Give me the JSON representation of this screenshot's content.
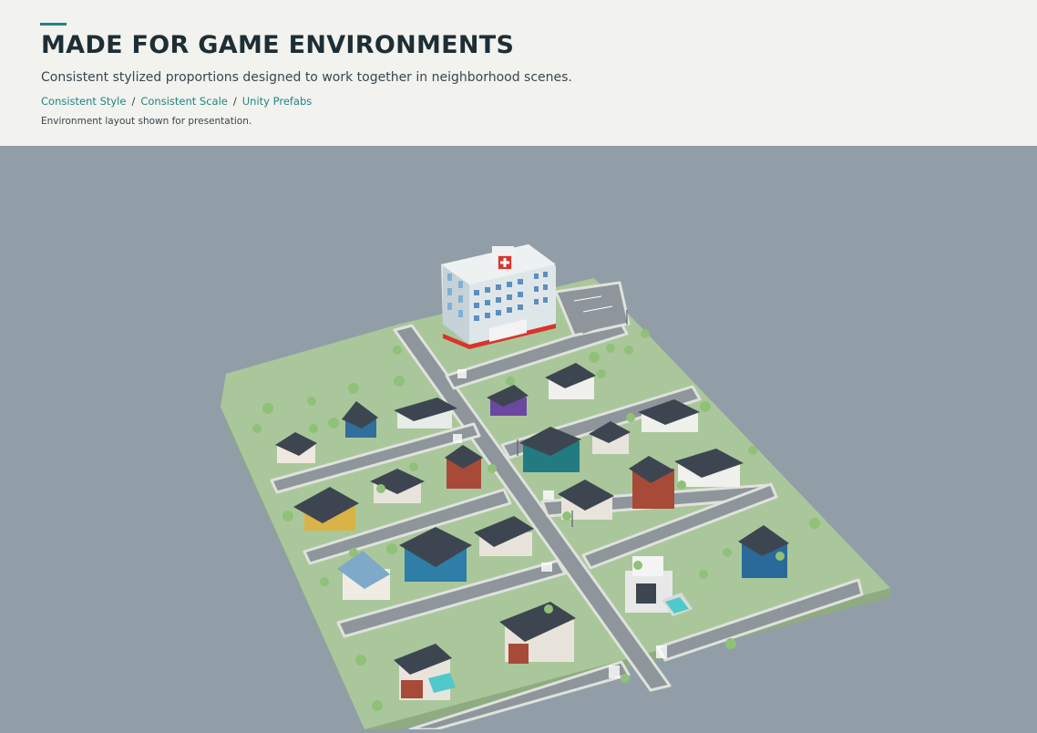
{
  "header": {
    "title": "MADE FOR GAME ENVIRONMENTS",
    "subtitle": "Consistent stylized proportions designed to work together in neighborhood scenes.",
    "tags": [
      "Consistent Style",
      "Consistent Scale",
      "Unity Prefabs"
    ],
    "tag_separator": "/",
    "caption": "Environment layout shown for presentation."
  },
  "colors": {
    "accent": "#1f8484",
    "title": "#1d2e35",
    "header_bg": "#f2f2ee",
    "scene_bg": "#919ea8",
    "grass": "#aac79b",
    "road": "#8e969b",
    "sidewalk": "#dfe2dd"
  },
  "scene": {
    "icons": [
      "hospital-building",
      "red-cross-sign",
      "house",
      "tree",
      "swimming-pool",
      "parking-lot",
      "street-lamp"
    ]
  }
}
